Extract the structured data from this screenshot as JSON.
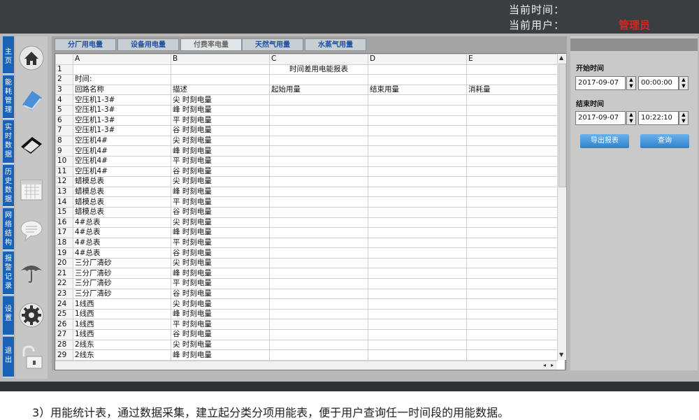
{
  "header": {
    "current_time_label": "当前时间：",
    "current_user_label": "当前用户：",
    "current_user_value": "管理员"
  },
  "nav": [
    {
      "label": "主页",
      "icon": "home-icon"
    },
    {
      "label": "能耗管理",
      "icon": "book-icon"
    },
    {
      "label": "实时数据",
      "icon": "notebook-icon"
    },
    {
      "label": "历史数据",
      "icon": "calendar-icon"
    },
    {
      "label": "网络结构",
      "icon": "chat-bubble-icon"
    },
    {
      "label": "报警记录",
      "icon": "umbrella-icon"
    },
    {
      "label": "设置",
      "icon": "gear-icon"
    },
    {
      "label": "退出",
      "icon": "unlock-icon"
    }
  ],
  "tabs": [
    "分厂用电量",
    "设备用电量",
    "付费率电量",
    "天然气用量",
    "水蒸气用量"
  ],
  "active_tab": 2,
  "sheet": {
    "columns": [
      "A",
      "B",
      "C",
      "D",
      "E"
    ],
    "title": "时间差用电能报表",
    "time_label": "时间:",
    "headers": [
      "回路名称",
      "描述",
      "起始用量",
      "结束用量",
      "消耗量"
    ],
    "rows": [
      [
        "空压机1-3#",
        "尖 时刻电量"
      ],
      [
        "空压机1-3#",
        "峰 时刻电量"
      ],
      [
        "空压机1-3#",
        "平 时刻电量"
      ],
      [
        "空压机1-3#",
        "谷 时刻电量"
      ],
      [
        "空压机4#",
        "尖 时刻电量"
      ],
      [
        "空压机4#",
        "峰 时刻电量"
      ],
      [
        "空压机4#",
        "平 时刻电量"
      ],
      [
        "空压机4#",
        "谷 时刻电量"
      ],
      [
        "蜡模总表",
        "尖 时刻电量"
      ],
      [
        "蜡模总表",
        "峰 时刻电量"
      ],
      [
        "蜡模总表",
        "平 时刻电量"
      ],
      [
        "蜡模总表",
        "谷 时刻电量"
      ],
      [
        "4#总表",
        "尖 时刻电量"
      ],
      [
        "4#总表",
        "峰 时刻电量"
      ],
      [
        "4#总表",
        "平 时刻电量"
      ],
      [
        "4#总表",
        "谷 时刻电量"
      ],
      [
        "三分厂清砂",
        "尖 时刻电量"
      ],
      [
        "三分厂清砂",
        "峰 时刻电量"
      ],
      [
        "三分厂清砂",
        "平 时刻电量"
      ],
      [
        "三分厂清砂",
        "谷 时刻电量"
      ],
      [
        "1线西",
        "尖 时刻电量"
      ],
      [
        "1线西",
        "峰 时刻电量"
      ],
      [
        "1线西",
        "平 时刻电量"
      ],
      [
        "1线西",
        "谷 时刻电量"
      ],
      [
        "2线东",
        "尖 时刻电量"
      ],
      [
        "2线东",
        "峰 时刻电量"
      ]
    ]
  },
  "query_panel": {
    "start_label": "开始时间",
    "start_date": "2017-09-07",
    "start_time": "00:00:00",
    "end_label": "结束时间",
    "end_date": "2017-09-07",
    "end_time": "10:22:10",
    "export_button": "导出报表",
    "query_button": "查询"
  },
  "caption": "3）用能统计表，通过数据采集，建立起分类分项用能表，便于用户查询任一时间段的用能数据。",
  "colors": {
    "nav_blue": "#1b62b6",
    "user_red": "#d9261c",
    "button_blue": "#2f81cf"
  }
}
